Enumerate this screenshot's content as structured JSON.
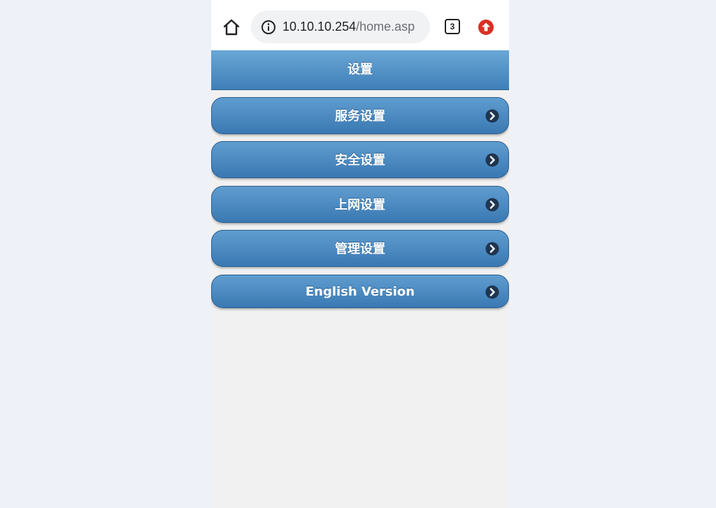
{
  "browser": {
    "url_host": "10.10.10.254",
    "url_path": "/home.asp",
    "tab_count": "3",
    "icons": {
      "home": "home-icon",
      "info": "info-icon",
      "tabs": "tabs-icon",
      "update": "update-arrow-icon"
    }
  },
  "header": {
    "title": "设置"
  },
  "menu": {
    "items": [
      {
        "label": "服务设置"
      },
      {
        "label": "安全设置"
      },
      {
        "label": "上网设置"
      },
      {
        "label": "管理设置"
      },
      {
        "label": "English Version"
      }
    ],
    "arrow_icon": "chevron-right-icon"
  },
  "colors": {
    "page_background": "#eef1f8",
    "content_background": "#f1f1f1",
    "button_gradient_top": "#5f9dd0",
    "button_gradient_bottom": "#3a78b2",
    "update_red": "#d93025"
  }
}
